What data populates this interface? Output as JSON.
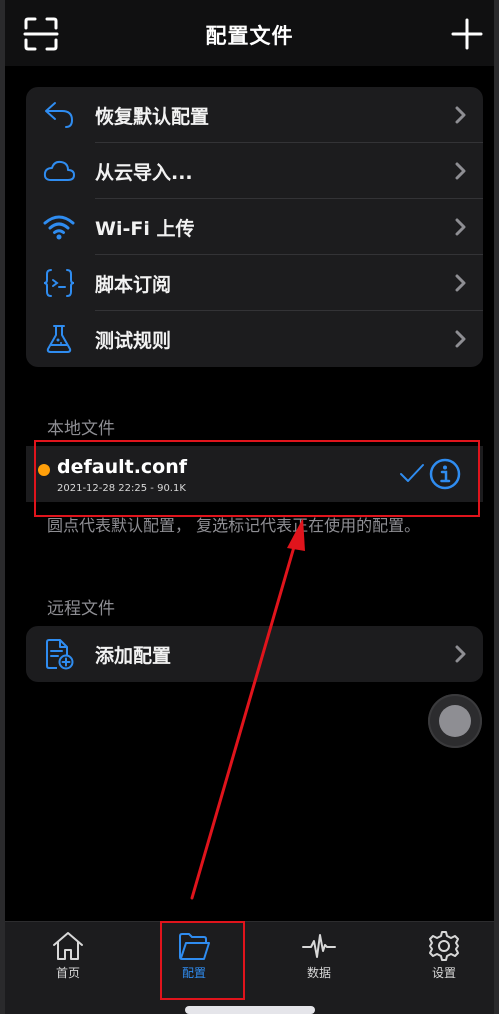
{
  "nav": {
    "title": "配置文件"
  },
  "menu": [
    {
      "label": "恢复默认配置",
      "icon": "undo-arrow-icon"
    },
    {
      "label": "从云导入...",
      "icon": "cloud-icon"
    },
    {
      "label": "Wi-Fi 上传",
      "icon": "wifi-icon"
    },
    {
      "label": "脚本订阅",
      "icon": "script-braces-icon"
    },
    {
      "label": "测试规则",
      "icon": "flask-icon"
    }
  ],
  "local": {
    "section_title": "本地文件",
    "file": {
      "name": "default.conf",
      "meta": "2021-12-28 22:25 - 90.1K",
      "default": true,
      "active": true
    },
    "footnote": "圆点代表默认配置， 复选标记代表正在使用的配置。"
  },
  "remote": {
    "section_title": "远程文件",
    "add_label": "添加配置"
  },
  "tabs": [
    {
      "label": "首页",
      "icon": "home-icon",
      "active": false
    },
    {
      "label": "配置",
      "icon": "folder-icon",
      "active": true
    },
    {
      "label": "数据",
      "icon": "waveform-icon",
      "active": false
    },
    {
      "label": "设置",
      "icon": "gear-icon",
      "active": false
    }
  ],
  "colors": {
    "accent": "#2f8cf0",
    "default_dot": "#ff9f0a",
    "annotation": "#e0141c",
    "card": "#1c1c1e",
    "secondary_text": "#8e8e93"
  }
}
